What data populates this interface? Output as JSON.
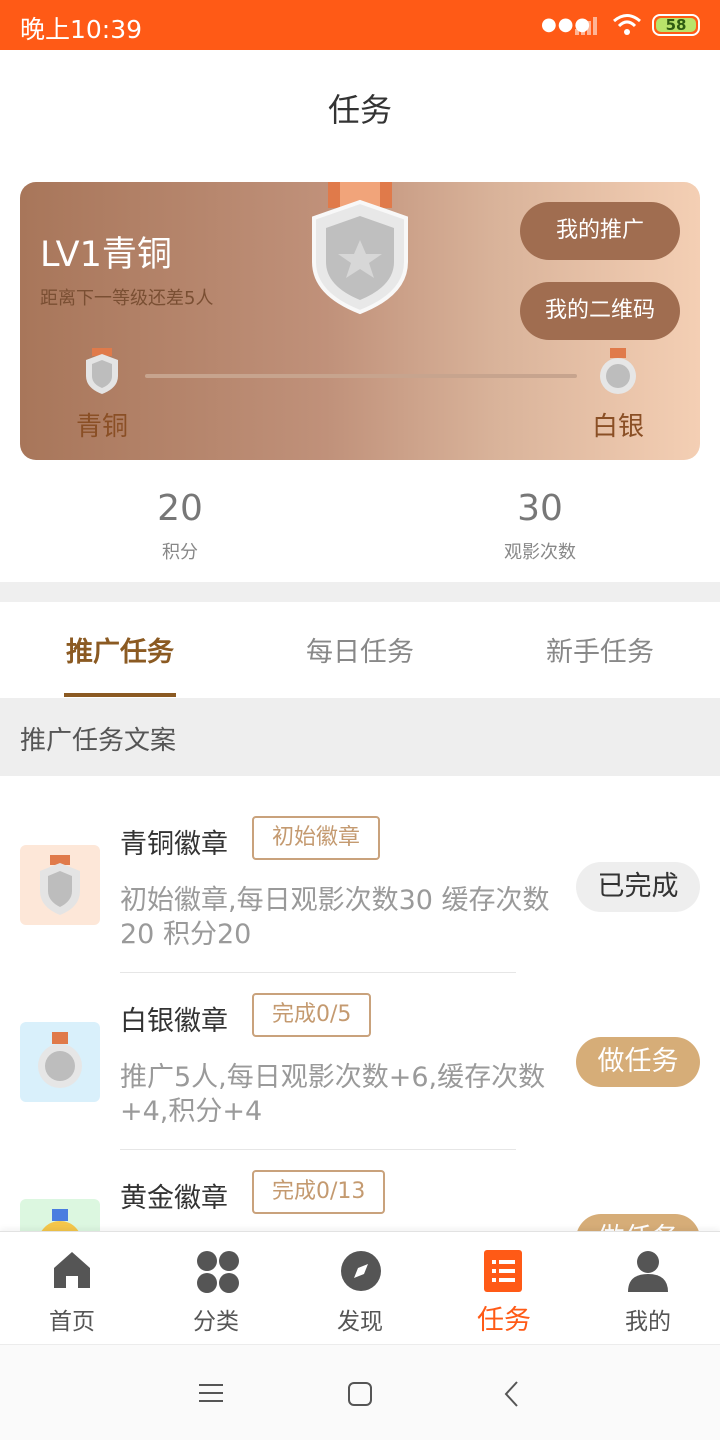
{
  "status_bar": {
    "time": "晚上10:39",
    "battery": "58"
  },
  "header": {
    "title": "任务"
  },
  "level_card": {
    "level_title": "LV1青铜",
    "distance_text": "距离下一等级还差5人",
    "btn_promotion": "我的推广",
    "btn_qrcode": "我的二维码",
    "current_level": "青铜",
    "next_level": "白银",
    "progress_fraction": 0
  },
  "stats": [
    {
      "value": "20",
      "label": "积分"
    },
    {
      "value": "30",
      "label": "观影次数"
    }
  ],
  "tabs": [
    {
      "label": "推广任务",
      "active": true
    },
    {
      "label": "每日任务",
      "active": false
    },
    {
      "label": "新手任务",
      "active": false
    }
  ],
  "section_title": "推广任务文案",
  "tasks": [
    {
      "name": "青铜徽章",
      "tag": "初始徽章",
      "desc": "初始徽章,每日观影次数30 缓存次数20 积分20",
      "button": "已完成",
      "status": "done"
    },
    {
      "name": "白银徽章",
      "tag": "完成0/5",
      "desc": "推广5人,每日观影次数+6,缓存次数+4,积分+4",
      "button": "做任务",
      "status": "todo"
    },
    {
      "name": "黄金徽章",
      "tag": "完成0/13",
      "desc": "",
      "button": "做任务",
      "status": "todo"
    }
  ],
  "bottom_nav": [
    {
      "label": "首页",
      "icon": "home-icon"
    },
    {
      "label": "分类",
      "icon": "category-icon"
    },
    {
      "label": "发现",
      "icon": "compass-icon"
    },
    {
      "label": "任务",
      "icon": "task-list-icon",
      "active": true
    },
    {
      "label": "我的",
      "icon": "user-icon"
    }
  ],
  "colors": {
    "accent": "#ff5a16",
    "brown": "#8b5a22",
    "gold": "#d6ad78"
  }
}
